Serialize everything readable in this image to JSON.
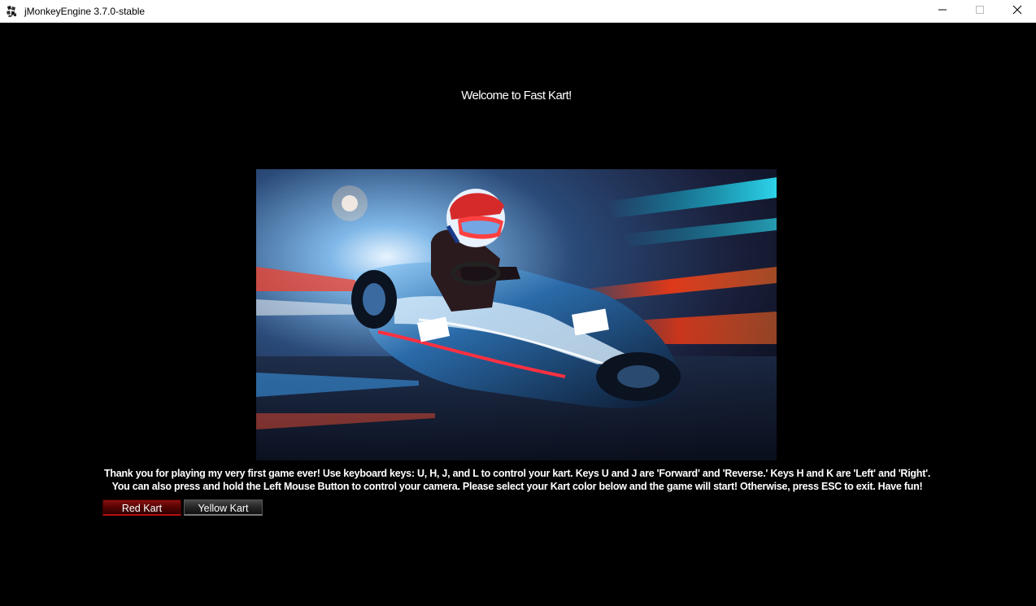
{
  "window": {
    "title": "jMonkeyEngine 3.7.0-stable",
    "controls": {
      "minimize_icon": "minimize-icon",
      "maximize_icon": "maximize-icon",
      "close_icon": "close-icon"
    }
  },
  "game": {
    "welcome_text": "Welcome to Fast Kart!",
    "splash_image": "go-kart-racer-illustration",
    "instructions": "Thank you for playing my very first game ever!   Use keyboard keys: U, H, J, and L to control your kart.   Keys U and J are 'Forward' and 'Reverse.'   Keys H and K are 'Left' and 'Right'. You can also press and hold the Left Mouse Button to control your camera.   Please select your Kart color below and the game will start!  Otherwise, press ESC to exit. Have fun!",
    "buttons": {
      "red_kart": "Red Kart",
      "yellow_kart": "Yellow Kart"
    }
  },
  "colors": {
    "background": "#000000",
    "red_button": "#8a1010",
    "yellow_button": "#262626",
    "text": "#ffffff"
  }
}
